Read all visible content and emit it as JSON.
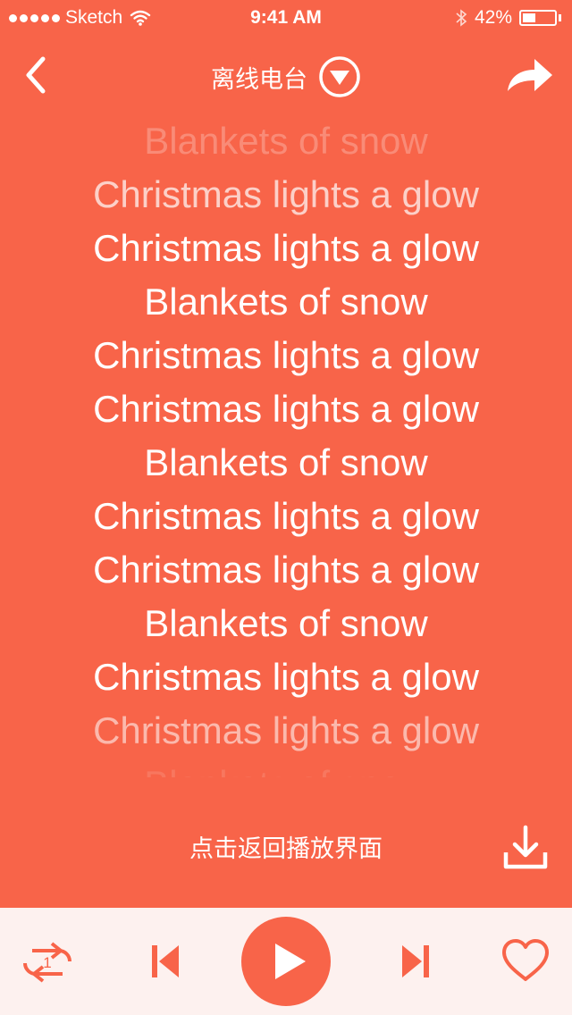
{
  "status_bar": {
    "carrier": "Sketch",
    "time": "9:41 AM",
    "battery_percent": "42%",
    "battery_level": 0.42
  },
  "nav": {
    "title": "离线电台",
    "back_icon": "chevron-left-icon",
    "dropdown_icon": "circle-dropdown-icon",
    "share_icon": "share-icon"
  },
  "lyrics": [
    {
      "text": "Blankets of snow",
      "opacity": 0.25
    },
    {
      "text": "Christmas lights a glow",
      "opacity": 0.7
    },
    {
      "text": "Christmas lights a glow",
      "opacity": 1
    },
    {
      "text": "Blankets of snow",
      "opacity": 1
    },
    {
      "text": "Christmas lights a glow",
      "opacity": 1
    },
    {
      "text": "Christmas lights a glow",
      "opacity": 1
    },
    {
      "text": "Blankets of snow",
      "opacity": 1
    },
    {
      "text": "Christmas lights a glow",
      "opacity": 1
    },
    {
      "text": "Christmas lights a glow",
      "opacity": 1
    },
    {
      "text": "Blankets of snow",
      "opacity": 1
    },
    {
      "text": "Christmas lights a glow",
      "opacity": 1
    },
    {
      "text": "Christmas lights a glow",
      "opacity": 0.55
    },
    {
      "text": "Blankets of snow",
      "opacity": 0.12
    }
  ],
  "hint": {
    "text": "点击返回播放界面",
    "download_icon": "download-icon"
  },
  "player": {
    "repeat_icon": "repeat-one-icon",
    "repeat_badge": "1",
    "prev_icon": "skip-previous-icon",
    "play_icon": "play-icon",
    "next_icon": "skip-next-icon",
    "heart_icon": "heart-icon"
  },
  "colors": {
    "accent": "#f86449",
    "player_bg": "#fdf1ef",
    "text": "#ffffff"
  }
}
